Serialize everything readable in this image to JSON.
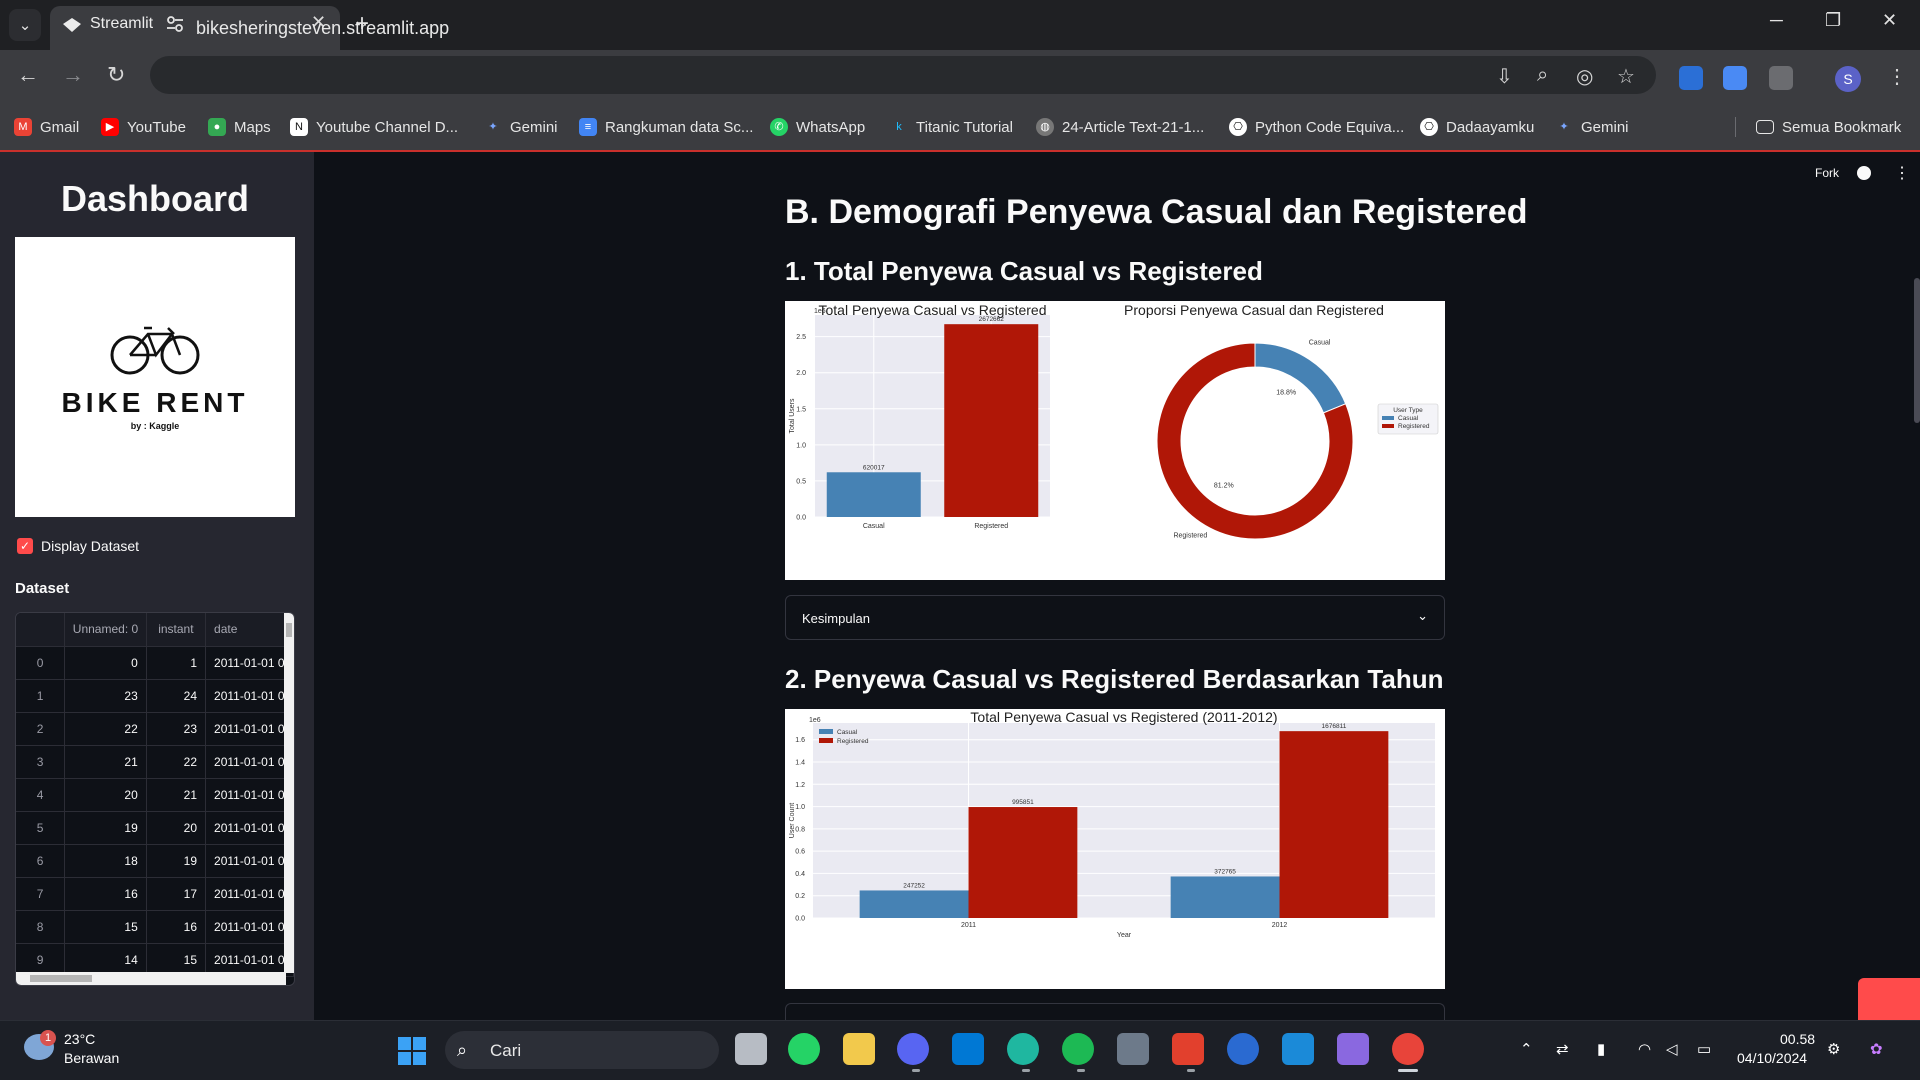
{
  "browser": {
    "tab_title": "Streamlit",
    "url": "bikesheringsteven.streamlit.app",
    "bookmarks": [
      {
        "label": "Gmail",
        "icon": "gmail-icon",
        "color": "#ea4335"
      },
      {
        "label": "YouTube",
        "icon": "youtube-icon",
        "color": "#ff0000"
      },
      {
        "label": "Maps",
        "icon": "maps-icon",
        "color": "#34a853"
      },
      {
        "label": "Youtube Channel D...",
        "icon": "notion-icon",
        "color": "#444444"
      },
      {
        "label": "Gemini",
        "icon": "gemini-icon",
        "color": "#5b8def"
      },
      {
        "label": "Rangkuman data Sc...",
        "icon": "docs-icon",
        "color": "#4285f4"
      },
      {
        "label": "WhatsApp",
        "icon": "whatsapp-icon",
        "color": "#25d366"
      },
      {
        "label": "Titanic Tutorial",
        "icon": "kaggle-icon",
        "color": "#20beff"
      },
      {
        "label": "24-Article Text-21-1...",
        "icon": "globe-icon",
        "color": "#6c6c6c"
      },
      {
        "label": "Python Code Equiva...",
        "icon": "chatgpt-icon",
        "color": "#6c6c6c"
      },
      {
        "label": "Dadaayamku",
        "icon": "chatgpt-icon",
        "color": "#6c6c6c"
      },
      {
        "label": "Gemini",
        "icon": "gemini-icon",
        "color": "#5b8def"
      }
    ],
    "all_bookmarks": "Semua Bookmark",
    "profile_initial": "S"
  },
  "sidebar": {
    "title": "Dashboard",
    "logo_text": "BIKE RENT",
    "logo_sub": "by : Kaggle",
    "checkbox_label": "Display Dataset",
    "dataset_title": "Dataset",
    "table": {
      "columns": [
        "",
        "Unnamed: 0",
        "instant",
        "date"
      ],
      "rows": [
        [
          "0",
          "0",
          "1",
          "2011-01-01 00"
        ],
        [
          "1",
          "23",
          "24",
          "2011-01-01 00"
        ],
        [
          "2",
          "22",
          "23",
          "2011-01-01 00"
        ],
        [
          "3",
          "21",
          "22",
          "2011-01-01 00"
        ],
        [
          "4",
          "20",
          "21",
          "2011-01-01 00"
        ],
        [
          "5",
          "19",
          "20",
          "2011-01-01 00"
        ],
        [
          "6",
          "18",
          "19",
          "2011-01-01 00"
        ],
        [
          "7",
          "16",
          "17",
          "2011-01-01 00"
        ],
        [
          "8",
          "15",
          "16",
          "2011-01-01 00"
        ],
        [
          "9",
          "14",
          "15",
          "2011-01-01 00"
        ]
      ]
    }
  },
  "header": {
    "fork_label": "Fork"
  },
  "main": {
    "section_title": "B. Demografi Penyewa Casual dan Registered",
    "sub1_title": "1. Total Penyewa Casual vs Registered",
    "expander_label": "Kesimpulan",
    "sub2_title": "2. Penyewa Casual vs Registered Berdasarkan Tahun"
  },
  "colors": {
    "casual": "#4682b4",
    "registered": "#b01707",
    "plot_bg": "#eaeaf2",
    "accent": "#ff4b4b"
  },
  "chart_data": [
    {
      "type": "bar",
      "title": "Total Penyewa Casual vs Registered",
      "categories": [
        "Casual",
        "Registered"
      ],
      "values": [
        620017,
        2672662
      ],
      "value_labels": [
        "620017",
        "2672662"
      ],
      "ylabel": "Total Users",
      "multiplier_label": "1e6",
      "ylim": [
        0,
        2.8
      ],
      "yticks": [
        "0.0",
        "0.5",
        "1.0",
        "1.5",
        "2.0",
        "2.5"
      ],
      "grid": true
    },
    {
      "type": "pie",
      "title": "Proporsi Penyewa Casual dan Registered",
      "donut": true,
      "slices": [
        {
          "label": "Casual",
          "percent_label": "18.8%",
          "value": 18.8
        },
        {
          "label": "Registered",
          "percent_label": "81.2%",
          "value": 81.2
        }
      ],
      "legend_title": "User Type",
      "legend_items": [
        "Casual",
        "Registered"
      ],
      "legend_position": "right"
    },
    {
      "type": "bar",
      "title": "Total Penyewa Casual vs Registered (2011-2012)",
      "categories": [
        "2011",
        "2012"
      ],
      "series": [
        {
          "name": "Casual",
          "values": [
            247252,
            372765
          ],
          "labels": [
            "247252",
            "372765"
          ]
        },
        {
          "name": "Registered",
          "values": [
            995851,
            1676811
          ],
          "labels": [
            "995851",
            "1676811"
          ]
        }
      ],
      "xlabel": "Year",
      "ylabel": "User Count",
      "multiplier_label": "1e6",
      "ylim": [
        0,
        1.75
      ],
      "yticks": [
        "0.0",
        "0.2",
        "0.4",
        "0.6",
        "0.8",
        "1.0",
        "1.2",
        "1.4",
        "1.6"
      ],
      "legend_position": "top-left",
      "grid": true
    }
  ],
  "taskbar": {
    "temperature": "23°C",
    "weather": "Berawan",
    "weather_badge": "1",
    "search_placeholder": "Cari",
    "time": "00.58",
    "date": "04/10/2024"
  }
}
